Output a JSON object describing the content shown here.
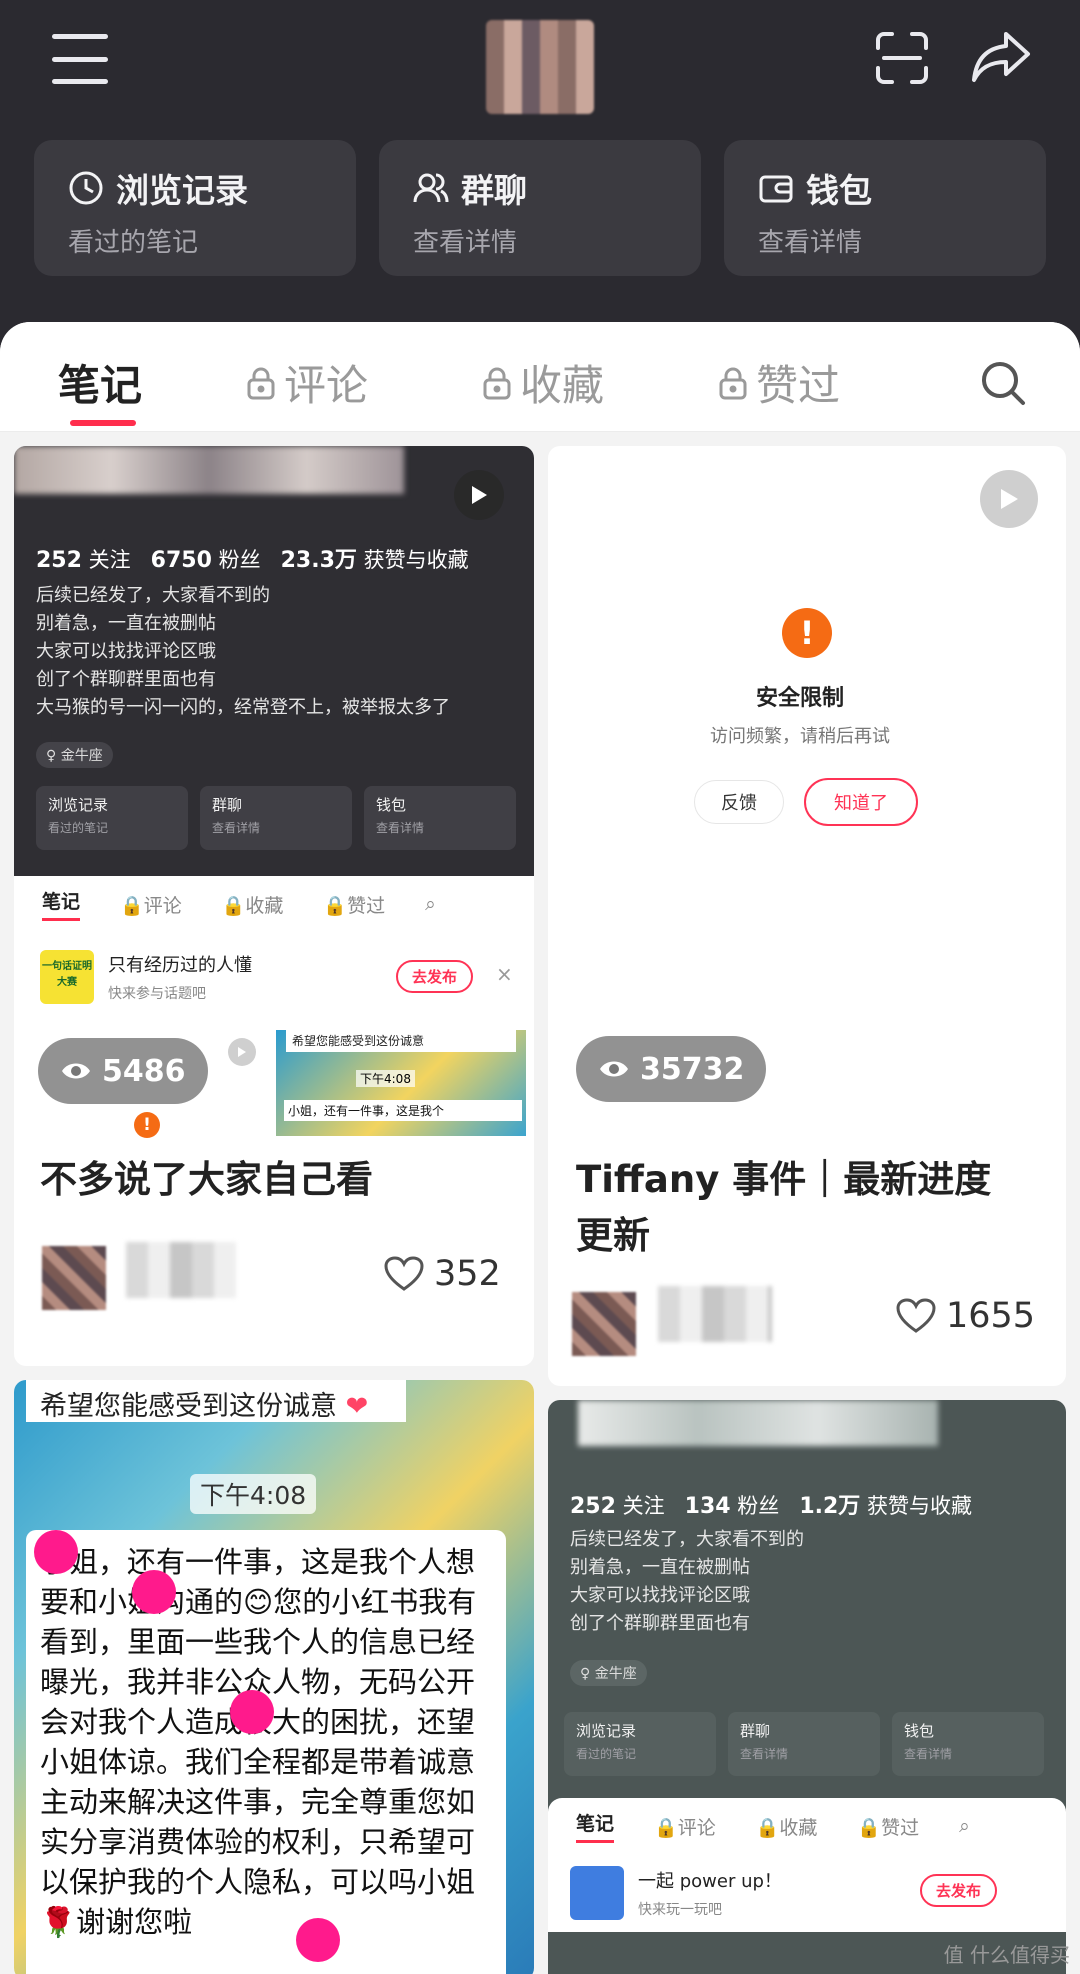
{
  "header": {
    "quick": [
      {
        "title": "浏览记录",
        "sub": "看过的笔记",
        "icon": "clock-icon"
      },
      {
        "title": "群聊",
        "sub": "查看详情",
        "icon": "group-icon"
      },
      {
        "title": "钱包",
        "sub": "查看详情",
        "icon": "wallet-icon"
      }
    ]
  },
  "tabs": {
    "notes": "笔记",
    "comments": "评论",
    "favorites": "收藏",
    "liked": "赞过"
  },
  "card1": {
    "stats": {
      "follow_num": "252",
      "follow": "关注",
      "fans_num": "6750",
      "fans": "粉丝",
      "likes_num": "23.3万",
      "likes": "获赞与收藏"
    },
    "lines": [
      "后续已经发了，大家看不到的",
      "别着急，一直在被删帖",
      "大家可以找找评论区哦",
      "创了个群聊群里面也有",
      "大马猴的号一闪一闪的，经常登不上，被举报太多了"
    ],
    "zodiac": "金牛座",
    "mini_quick": [
      {
        "t": "浏览记录",
        "s": "看过的笔记"
      },
      {
        "t": "群聊",
        "s": "查看详情"
      },
      {
        "t": "钱包",
        "s": "查看详情"
      }
    ],
    "mini_tabs": [
      "笔记",
      "评论",
      "收藏",
      "赞过"
    ],
    "promo": {
      "icon_text": "一句话证明大赛",
      "title": "只有经历过的人懂",
      "sub": "快来参与话题吧",
      "btn": "去发布",
      "close": "×"
    },
    "views": "5486",
    "thumb": {
      "banner": "希望您能感受到这份诚意",
      "time": "下午4:08",
      "line": "小姐，还有一件事，这是我个"
    },
    "title": "不多说了大家自己看",
    "likes": "352"
  },
  "card2": {
    "sec_title": "安全限制",
    "sec_sub": "访问频繁，请稍后再试",
    "feedback": "反馈",
    "ok": "知道了",
    "views": "35732",
    "title_l1": "Tiffany 事件｜最新进度",
    "title_l2": "更新",
    "likes": "1655"
  },
  "card3": {
    "banner": "希望您能感受到这份诚意",
    "time": "下午4:08",
    "text": "小姐，还有一件事，这是我个人想要和小姐沟通的😊您的小红书我有看到，里面一些我个人的信息已经曝光，我并非公众人物，无码公开会对我个人造成很大的困扰，还望小姐体谅。我们全程都是带着诚意主动来解决这件事，完全尊重您如实分享消费体验的权利，只希望可以保护我的个人隐私，可以吗小姐🌹谢谢您啦"
  },
  "card4": {
    "stats": {
      "follow_num": "252",
      "follow": "关注",
      "fans_num": "134",
      "fans": "粉丝",
      "likes_num": "1.2万",
      "likes": "获赞与收藏"
    },
    "lines": [
      "后续已经发了，大家看不到的",
      "别着急，一直在被删帖",
      "大家可以找找评论区哦",
      "创了个群聊群里面也有"
    ],
    "zodiac": "金牛座",
    "mini_quick": [
      {
        "t": "浏览记录",
        "s": "看过的笔记"
      },
      {
        "t": "群聊",
        "s": "查看详情"
      },
      {
        "t": "钱包",
        "s": "查看详情"
      }
    ],
    "mini_tabs": [
      "笔记",
      "评论",
      "收藏",
      "赞过"
    ],
    "promo": {
      "title": "一起 power up！",
      "sub": "快来玩一玩吧",
      "btn": "去发布"
    }
  },
  "watermark": "值 什么值得买"
}
